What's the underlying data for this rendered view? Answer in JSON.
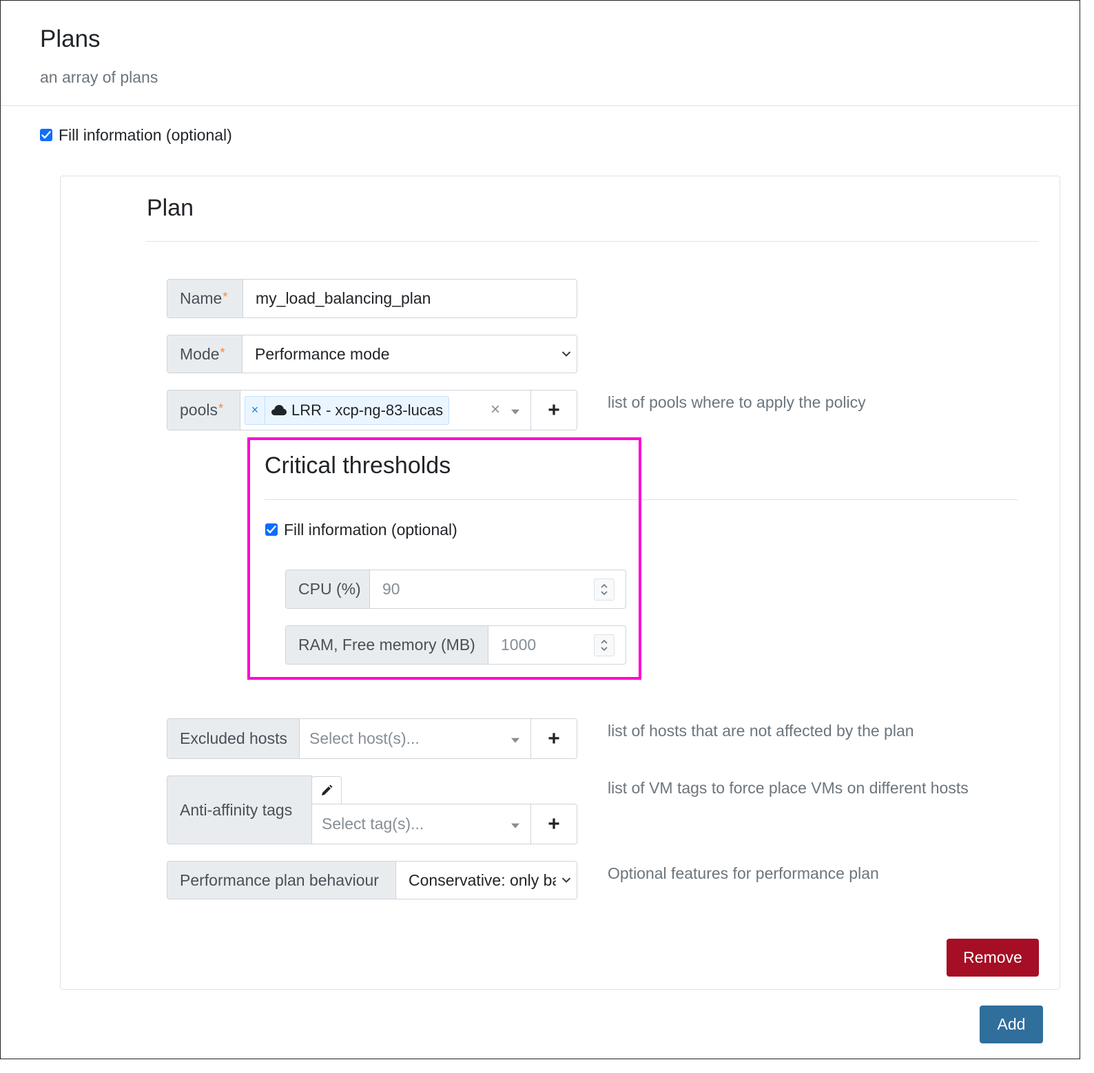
{
  "header": {
    "title": "Plans",
    "subtitle": "an array of plans",
    "fill_checkbox_label": "Fill information (optional)"
  },
  "plan": {
    "title": "Plan",
    "name": {
      "label": "Name",
      "required_mark": "*",
      "value": "my_load_balancing_plan"
    },
    "mode": {
      "label": "Mode",
      "required_mark": "*",
      "value": "Performance mode"
    },
    "pools": {
      "label": "pools",
      "required_mark": "*",
      "chip": "LRR - xcp-ng-83-lucas",
      "chip_remove": "×",
      "clear": "×",
      "add": "+",
      "help": "list of pools where to apply the policy"
    },
    "critical_thresholds": {
      "title": "Critical thresholds",
      "fill_checkbox_label": "Fill information (optional)",
      "cpu": {
        "label": "CPU (%)",
        "placeholder": "90"
      },
      "ram": {
        "label": "RAM, Free memory (MB)",
        "placeholder": "1000"
      }
    },
    "excluded_hosts": {
      "label": "Excluded hosts",
      "placeholder": "Select host(s)...",
      "add": "+",
      "help": "list of hosts that are not affected by the plan"
    },
    "anti_affinity": {
      "label": "Anti-affinity tags",
      "placeholder": "Select tag(s)...",
      "add": "+",
      "help": "list of VM tags to force place VMs on different hosts"
    },
    "performance_behaviour": {
      "label": "Performance plan behaviour",
      "value": "Conservative: only ba",
      "help": "Optional features for performance plan"
    },
    "remove_label": "Remove"
  },
  "add_label": "Add",
  "colors": {
    "highlight": "#ff00d4",
    "remove_button": "#a50e24",
    "add_button": "#306e9c",
    "checkbox": "#0d6efd"
  }
}
